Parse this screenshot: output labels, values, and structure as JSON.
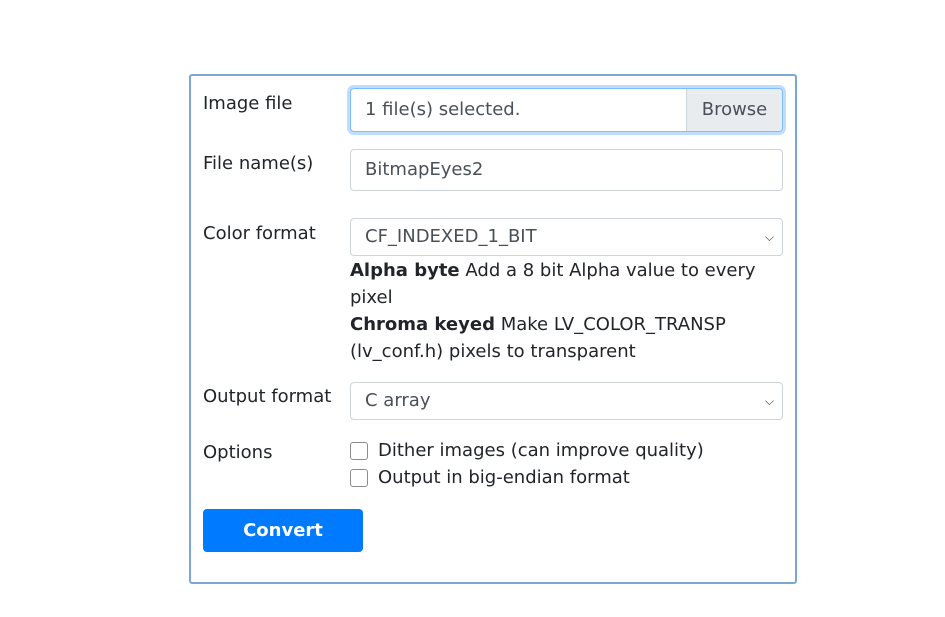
{
  "form": {
    "image_file": {
      "label": "Image file",
      "status": "1 file(s) selected.",
      "browse_label": "Browse"
    },
    "file_name": {
      "label": "File name(s)",
      "value": "BitmapEyes2"
    },
    "color_format": {
      "label": "Color format",
      "selected": "CF_INDEXED_1_BIT",
      "help": [
        {
          "term": "Alpha byte",
          "desc": "Add a 8 bit Alpha value to every pixel"
        },
        {
          "term": "Chroma keyed",
          "desc": "Make LV_COLOR_TRANSP (lv_conf.h) pixels to transparent"
        }
      ]
    },
    "output_format": {
      "label": "Output format",
      "selected": "C array"
    },
    "options": {
      "label": "Options",
      "items": [
        {
          "label": "Dither images (can improve quality)",
          "checked": false
        },
        {
          "label": "Output in big-endian format",
          "checked": false
        }
      ]
    },
    "convert_label": "Convert"
  },
  "colors": {
    "primary": "#007bff",
    "card_border": "#7aa7d6",
    "focus_border": "#80bdff"
  }
}
